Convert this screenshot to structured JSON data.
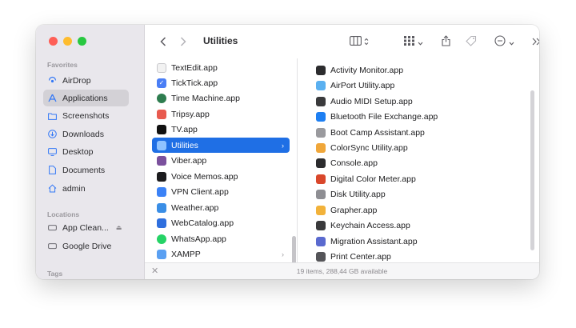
{
  "window": {
    "title": "Utilities"
  },
  "sidebar": {
    "sections": {
      "favorites": "Favorites",
      "locations": "Locations",
      "tags": "Tags"
    },
    "favorites": [
      {
        "label": "AirDrop",
        "icon": "airdrop-icon"
      },
      {
        "label": "Applications",
        "icon": "applications-icon"
      },
      {
        "label": "Screenshots",
        "icon": "folder-icon"
      },
      {
        "label": "Downloads",
        "icon": "downloads-icon"
      },
      {
        "label": "Desktop",
        "icon": "desktop-icon"
      },
      {
        "label": "Documents",
        "icon": "document-icon"
      },
      {
        "label": "admin",
        "icon": "home-icon"
      }
    ],
    "locations": [
      {
        "label": "App Clean...",
        "icon": "drive-icon"
      },
      {
        "label": "Google Drive",
        "icon": "drive-icon"
      }
    ]
  },
  "column1": [
    {
      "label": "TextEdit.app",
      "color": "#f2f2f2"
    },
    {
      "label": "TickTick.app",
      "color": "#4a7ef5"
    },
    {
      "label": "Time Machine.app",
      "color": "#2e7d4f"
    },
    {
      "label": "Tripsy.app",
      "color": "#e85a4f"
    },
    {
      "label": "TV.app",
      "color": "#111111"
    },
    {
      "label": "Utilities",
      "color": "#5aa0f2"
    },
    {
      "label": "Viber.app",
      "color": "#7b519d"
    },
    {
      "label": "Voice Memos.app",
      "color": "#1c1c1e"
    },
    {
      "label": "VPN Client.app",
      "color": "#3b82f6"
    },
    {
      "label": "Weather.app",
      "color": "#3a8ee6"
    },
    {
      "label": "WebCatalog.app",
      "color": "#2f6fde"
    },
    {
      "label": "WhatsApp.app",
      "color": "#25d366"
    },
    {
      "label": "XAMPP",
      "color": "#5aa0f2"
    }
  ],
  "column2": [
    {
      "label": "Activity Monitor.app",
      "color": "#2c2c2e"
    },
    {
      "label": "AirPort Utility.app",
      "color": "#5ab0f0"
    },
    {
      "label": "Audio MIDI Setup.app",
      "color": "#3a3a3c"
    },
    {
      "label": "Bluetooth File Exchange.app",
      "color": "#1e7ff2"
    },
    {
      "label": "Boot Camp Assistant.app",
      "color": "#9a9a9e"
    },
    {
      "label": "ColorSync Utility.app",
      "color": "#f0a73a"
    },
    {
      "label": "Console.app",
      "color": "#2c2c2e"
    },
    {
      "label": "Digital Color Meter.app",
      "color": "#d9472b"
    },
    {
      "label": "Disk Utility.app",
      "color": "#8e8e93"
    },
    {
      "label": "Grapher.app",
      "color": "#f2b23a"
    },
    {
      "label": "Keychain Access.app",
      "color": "#3a3a3c"
    },
    {
      "label": "Migration Assistant.app",
      "color": "#5a6acf"
    },
    {
      "label": "Print Center.app",
      "color": "#555559"
    }
  ],
  "status": {
    "text": "19 items, 288,44 GB available"
  },
  "colors": {
    "selection": "#1f6fe5",
    "accent": "#3478f6",
    "sidebar_bg": "#e9e7ec"
  }
}
